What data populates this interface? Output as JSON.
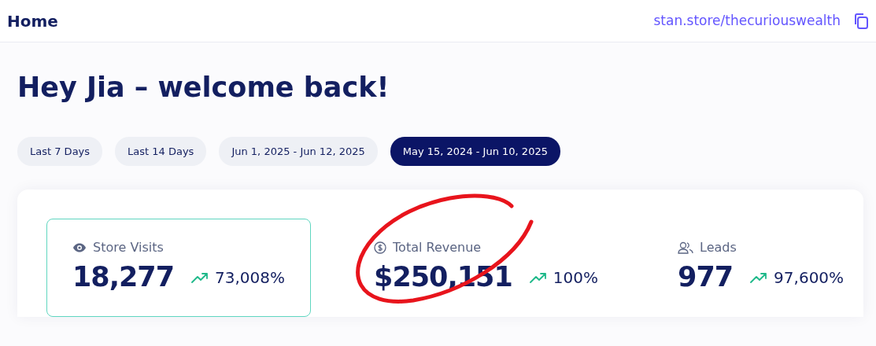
{
  "header": {
    "title": "Home",
    "store_link": "stan.store/thecuriouswealth"
  },
  "greeting": "Hey Jia – welcome back!",
  "date_ranges": [
    {
      "label": "Last 7 Days",
      "selected": false
    },
    {
      "label": "Last 14 Days",
      "selected": false
    },
    {
      "label": "Jun 1, 2025 - Jun 12, 2025",
      "selected": false
    },
    {
      "label": "May 15, 2024 - Jun 10, 2025",
      "selected": true
    }
  ],
  "stats": [
    {
      "kind": "visits",
      "label": "Store Visits",
      "value": "18,277",
      "change": "73,008%",
      "selected": true,
      "circled": false
    },
    {
      "kind": "revenue",
      "label": "Total Revenue",
      "value": "$250,151",
      "change": "100%",
      "selected": false,
      "circled": true
    },
    {
      "kind": "leads",
      "label": "Leads",
      "value": "977",
      "change": "97,600%",
      "selected": false,
      "circled": false
    }
  ]
}
